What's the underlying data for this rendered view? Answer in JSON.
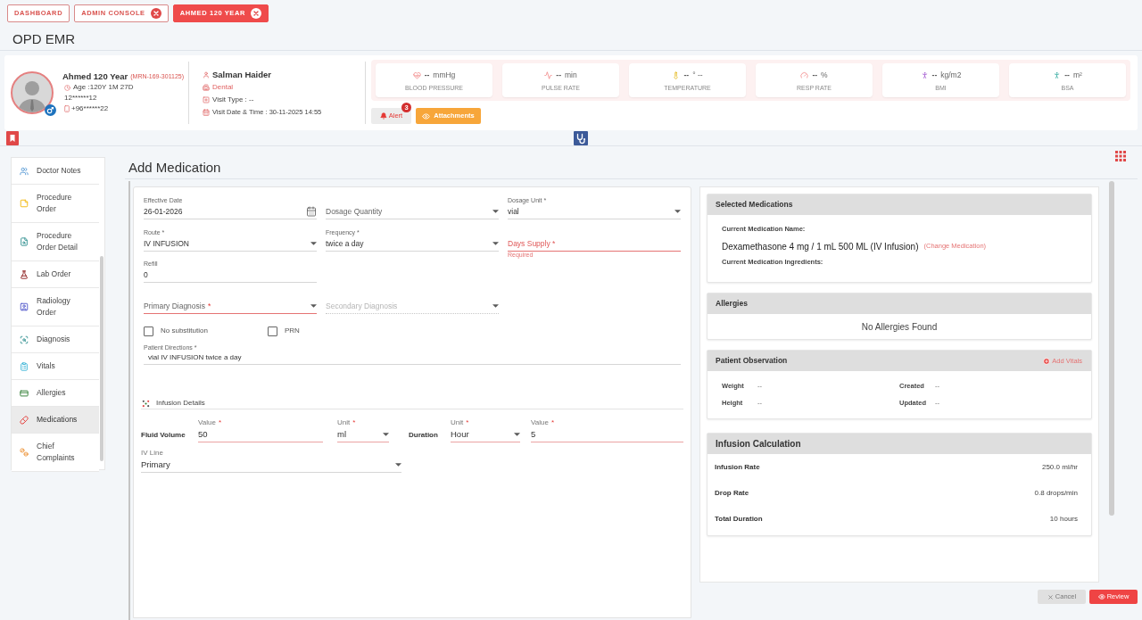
{
  "tabs": [
    {
      "label": "DASHBOARD",
      "selected": false,
      "closable": false
    },
    {
      "label": "ADMIN CONSOLE",
      "selected": false,
      "closable": true
    },
    {
      "label": "AHMED 120 YEAR",
      "selected": true,
      "closable": true
    }
  ],
  "page_title": "OPD EMR",
  "patient": {
    "name": "Ahmed 120 Year",
    "mrn": "(MRN-169-301125)",
    "age": "Age :120Y 1M 27D",
    "id_number": "12******12",
    "phone": "+96******22"
  },
  "visit": {
    "doctor": "Salman Haider",
    "department": "Dental",
    "visit_type": "Visit Type : --",
    "visit_date": "Visit Date & Time : 30-11-2025 14:55"
  },
  "vitals": [
    {
      "value": "--",
      "unit": "mmHg",
      "label": "BLOOD PRESSURE"
    },
    {
      "value": "--",
      "unit": "min",
      "label": "PULSE RATE"
    },
    {
      "value": "--",
      "unit": "° --",
      "label": "TEMPERATURE"
    },
    {
      "value": "--",
      "unit": "%",
      "label": "RESP RATE"
    },
    {
      "value": "--",
      "unit": "kg/m2",
      "label": "BMI"
    },
    {
      "value": "--",
      "unit": "m²",
      "label": "BSA"
    }
  ],
  "actions": [
    {
      "kind": "alert",
      "label": "Alert",
      "count": "3"
    },
    {
      "kind": "attachments",
      "label": "Attachments"
    }
  ],
  "sidebar": {
    "items": [
      {
        "label": "Doctor Notes",
        "selected": false
      },
      {
        "label": "Procedure Order",
        "selected": false
      },
      {
        "label": "Procedure Order Detail",
        "selected": false
      },
      {
        "label": "Lab Order",
        "selected": false
      },
      {
        "label": "Radiology Order",
        "selected": false
      },
      {
        "label": "Diagnosis",
        "selected": false
      },
      {
        "label": "Vitals",
        "selected": false
      },
      {
        "label": "Allergies",
        "selected": false
      },
      {
        "label": "Medications",
        "selected": true
      },
      {
        "label": "Chief Complaints",
        "selected": false
      }
    ]
  },
  "form": {
    "title": "Add Medication",
    "rows": [
      [
        {
          "kind": "date",
          "label": "Effective Date",
          "value": "26-01-2026",
          "error": false,
          "disabled": false
        },
        {
          "kind": "select",
          "placeholder": "Dosage Quantity",
          "error": false,
          "disabled": false
        },
        {
          "kind": "select",
          "label": "Dosage Unit *",
          "value": "vial",
          "error": false,
          "disabled": false
        }
      ],
      [
        {
          "kind": "select",
          "label": "Route *",
          "value": "IV INFUSION",
          "error": false,
          "disabled": false
        },
        {
          "kind": "select",
          "label": "Frequency *",
          "value": "twice a day",
          "error": false,
          "disabled": false
        },
        {
          "kind": "text",
          "placeholder": "Days Supply *",
          "error": true,
          "disabled": false,
          "helper": "Required"
        }
      ],
      [
        {
          "kind": "text",
          "label": "Refill",
          "value": "0",
          "error": false,
          "disabled": false
        }
      ],
      [
        {
          "kind": "select",
          "placeholder": "Primary Diagnosis",
          "mark": "*",
          "error": true,
          "disabled": false
        },
        {
          "kind": "select",
          "placeholder": "Secondary Diagnosis",
          "error": false,
          "disabled": true
        }
      ]
    ],
    "checkboxes": [
      {
        "label": "No substitution",
        "checked": false
      },
      {
        "label": "PRN",
        "checked": false
      }
    ],
    "directions": {
      "label": "Patient Directions *",
      "value": "vial IV INFUSION twice a day"
    }
  },
  "infusion": {
    "title": "Infusion Details",
    "groups": [
      {
        "label": "Fluid Volume",
        "fields": [
          {
            "kind": "text",
            "label": "Value",
            "mark": "*",
            "value": "50",
            "highlighted": true
          },
          {
            "kind": "select",
            "label": "Unit",
            "mark": "*",
            "value": "ml",
            "highlighted": true
          }
        ]
      },
      {
        "label": "Duration",
        "fields": [
          {
            "kind": "select",
            "label": "Unit",
            "mark": "*",
            "value": "Hour",
            "highlighted": true
          },
          {
            "kind": "text",
            "label": "Value",
            "mark": "*",
            "value": "5",
            "highlighted": true
          }
        ]
      }
    ],
    "iv_line": {
      "kind": "select",
      "label": "IV Line",
      "value": "Primary",
      "highlighted": false
    }
  },
  "selected_medications": {
    "title": "Selected Medications",
    "name_label": "Current Medication Name:",
    "name": "Dexamethasone 4 mg / 1 mL 500 ML (IV Infusion)",
    "change_link": "(Change Medication)",
    "ingredients_label": "Current Medication Ingredients:"
  },
  "allergies": {
    "title": "Allergies",
    "empty_text": "No Allergies Found"
  },
  "patient_observation": {
    "title": "Patient Observation",
    "add_link": "Add Vitals",
    "items": [
      {
        "label": "Weight",
        "value": "--"
      },
      {
        "label": "Created",
        "value": "--"
      },
      {
        "label": "Height",
        "value": "--"
      },
      {
        "label": "Updated",
        "value": "--"
      }
    ]
  },
  "infusion_calculation": {
    "title": "Infusion Calculation",
    "rows": [
      {
        "label": "Infusion Rate",
        "value": "250.0 ml/hr"
      },
      {
        "label": "Drop Rate",
        "value": "0.8 drops/min"
      },
      {
        "label": "Total Duration",
        "value": "10 hours"
      }
    ]
  },
  "footer_buttons": [
    {
      "kind": "cancel",
      "label": "Cancel"
    },
    {
      "kind": "review",
      "label": "Review"
    }
  ]
}
